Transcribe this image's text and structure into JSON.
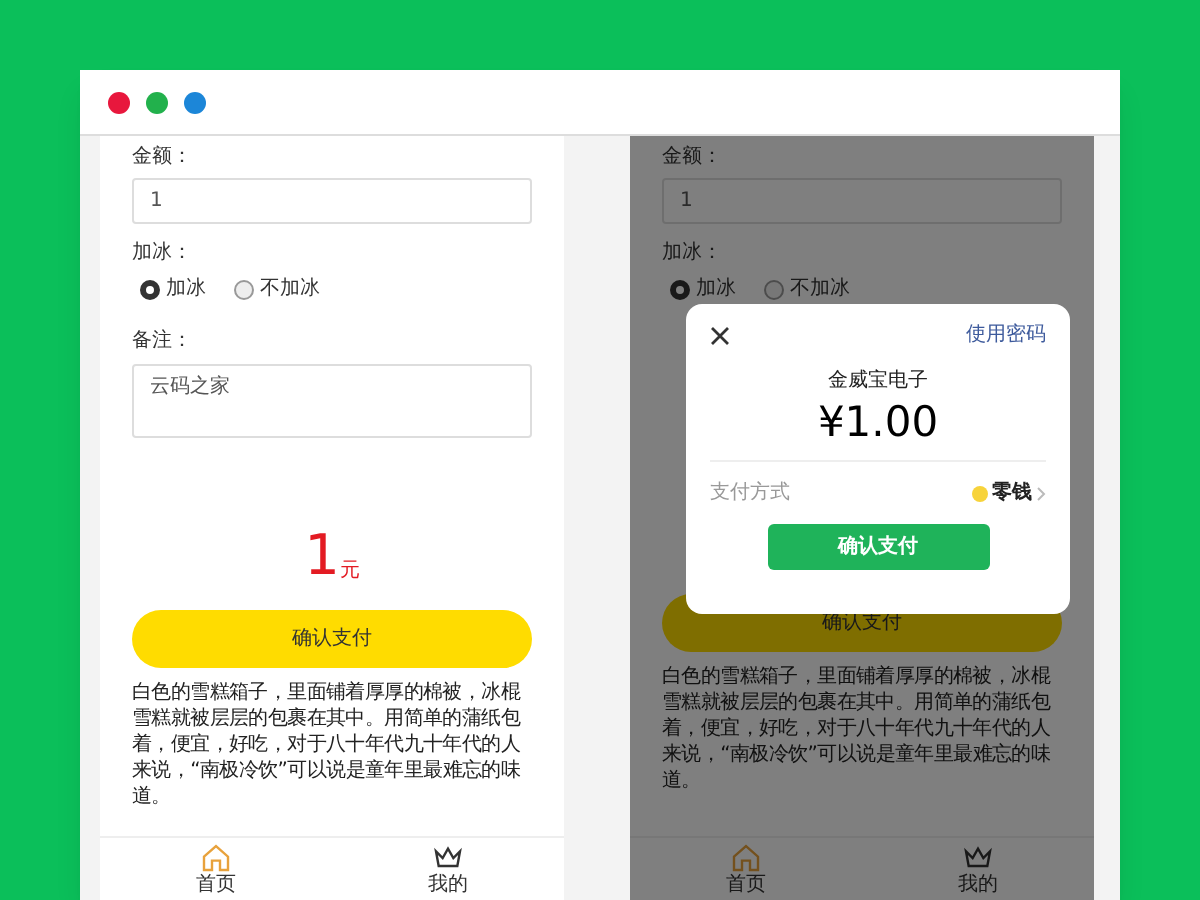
{
  "window": {
    "dots": [
      {
        "color": "#e8173d"
      },
      {
        "color": "#22b14c"
      },
      {
        "color": "#1c86d8"
      }
    ]
  },
  "screens": [
    {
      "dimmed": false,
      "amount_label": "金额：",
      "amount_value": "1",
      "ice_label": "加冰：",
      "ice_options": [
        {
          "label": "加冰",
          "selected": true
        },
        {
          "label": "不加冰",
          "selected": false
        }
      ],
      "remark_label": "备注：",
      "remark_value": "云码之家",
      "total": {
        "value": "1",
        "unit": "元"
      },
      "pay_button": "确认支付",
      "description": "白色的雪糕箱子，里面铺着厚厚的棉被，冰棍雪糕就被层层的包裹在其中。用简单的蒲纸包着，便宜，好吃，对于八十年代九十年代的人来说，“南极冷饮”可以说是童年里最难忘的味道。",
      "tabs": [
        {
          "label": "首页",
          "kind": "home",
          "selected": true
        },
        {
          "label": "我的",
          "kind": "crown",
          "selected": false
        }
      ]
    },
    {
      "dimmed": true,
      "amount_label": "金额：",
      "amount_value": "1",
      "ice_label": "加冰：",
      "ice_options": [
        {
          "label": "加冰",
          "selected": true
        },
        {
          "label": "不加冰",
          "selected": false
        }
      ],
      "pay_button": "确认支付",
      "description": "白色的雪糕箱子，里面铺着厚厚的棉被，冰棍雪糕就被层层的包裹在其中。用简单的蒲纸包着，便宜，好吃，对于八十年代九十年代的人来说，“南极冷饮”可以说是童年里最难忘的味道。",
      "tabs": [
        {
          "label": "首页",
          "kind": "home",
          "selected": true
        },
        {
          "label": "我的",
          "kind": "crown",
          "selected": false
        }
      ]
    }
  ],
  "payment_dialog": {
    "password_link": "使用密码",
    "merchant": "金威宝电子",
    "amount": "¥1.00",
    "method_label": "支付方式",
    "method_value": "零钱",
    "confirm_button": "确认支付"
  }
}
